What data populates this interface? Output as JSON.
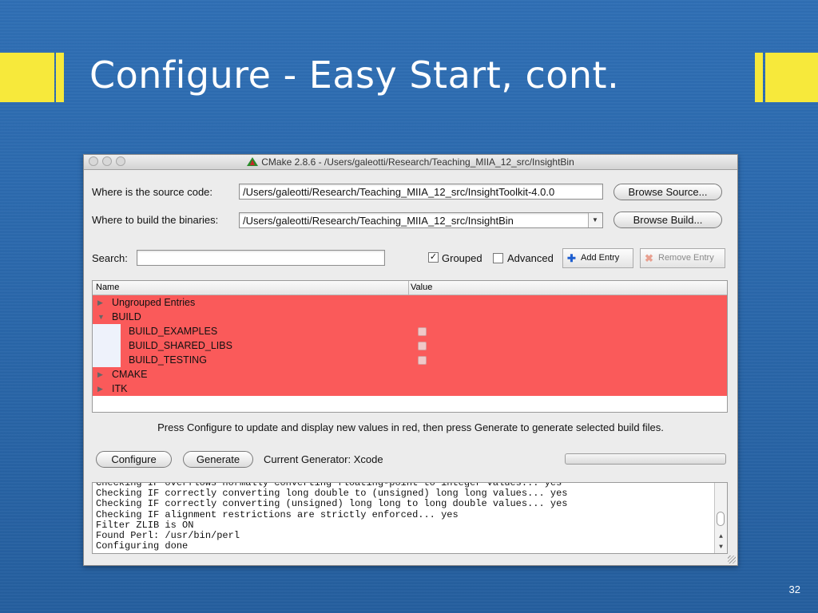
{
  "slide": {
    "title": "Configure - Easy Start, cont.",
    "page_number": "32",
    "accent_color": "#f7e93b"
  },
  "window": {
    "title": "CMake 2.8.6 - /Users/galeotti/Research/Teaching_MIIA_12_src/InsightBin",
    "source_label": "Where is the source code:",
    "source_value": "/Users/galeotti/Research/Teaching_MIIA_12_src/InsightToolkit-4.0.0",
    "browse_source": "Browse Source...",
    "build_label": "Where to build the binaries:",
    "build_value": "/Users/galeotti/Research/Teaching_MIIA_12_src/InsightBin",
    "browse_build": "Browse Build...",
    "search_label": "Search:",
    "search_value": "",
    "grouped_label": "Grouped",
    "grouped_checked": true,
    "advanced_label": "Advanced",
    "advanced_checked": false,
    "add_entry": "Add Entry",
    "remove_entry": "Remove Entry"
  },
  "tree": {
    "col_name": "Name",
    "col_value": "Value",
    "rows": [
      {
        "name": "Ungrouped Entries",
        "expander": "▶",
        "level": 0,
        "has_value": false
      },
      {
        "name": "BUILD",
        "expander": "▼",
        "level": 0,
        "has_value": false
      },
      {
        "name": "BUILD_EXAMPLES",
        "expander": "",
        "level": 1,
        "has_value": true
      },
      {
        "name": "BUILD_SHARED_LIBS",
        "expander": "",
        "level": 1,
        "has_value": true
      },
      {
        "name": "BUILD_TESTING",
        "expander": "",
        "level": 1,
        "has_value": true
      },
      {
        "name": "CMAKE",
        "expander": "▶",
        "level": 0,
        "has_value": false
      },
      {
        "name": "ITK",
        "expander": "▶",
        "level": 0,
        "has_value": false
      }
    ],
    "highlight_color": "#fa5a5a"
  },
  "hint": "Press Configure to update and display new values in red, then press Generate to generate selected build files.",
  "actions": {
    "configure": "Configure",
    "generate": "Generate",
    "generator": "Current Generator: Xcode"
  },
  "console": {
    "lines": [
      "Checking IF overflows normally converting floating-point to integer values... yes",
      "Checking IF correctly converting long double to (unsigned) long long values... yes",
      "Checking IF correctly converting (unsigned) long long to long double values... yes",
      "Checking IF alignment restrictions are strictly enforced... yes",
      "Filter ZLIB is ON",
      "Found Perl: /usr/bin/perl",
      "Configuring done"
    ]
  }
}
